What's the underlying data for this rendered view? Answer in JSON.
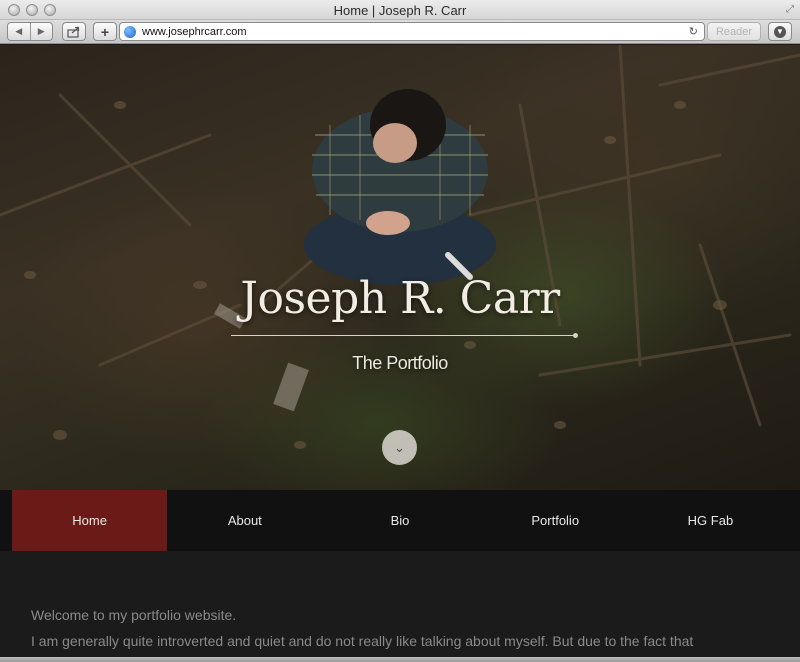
{
  "window": {
    "title": "Home | Joseph R. Carr"
  },
  "toolbar": {
    "url": "www.josephrcarr.com",
    "reader_label": "Reader"
  },
  "hero": {
    "title": "Joseph R. Carr",
    "subtitle": "The Portfolio"
  },
  "nav": {
    "items": [
      {
        "label": "Home",
        "active": true
      },
      {
        "label": "About"
      },
      {
        "label": "Bio"
      },
      {
        "label": "Portfolio"
      },
      {
        "label": "HG Fab"
      }
    ]
  },
  "content": {
    "line1": "Welcome to my portfolio website.",
    "line2": "I am generally quite introverted and quiet and do not really like talking about myself. But due to the fact that"
  },
  "colors": {
    "nav_active": "#6a1b17",
    "nav_bg": "#111111",
    "page_bg": "#1b1b1b"
  }
}
